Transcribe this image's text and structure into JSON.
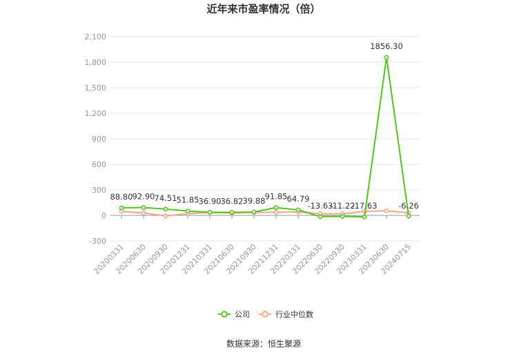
{
  "chart_data": {
    "type": "line",
    "title": "近年来市盈率情况（倍）",
    "categories": [
      "20200331",
      "20200630",
      "20200930",
      "20201231",
      "20210331",
      "20210630",
      "20210930",
      "20211231",
      "20220331",
      "20220630",
      "20220930",
      "20230331",
      "20230630",
      "20240715"
    ],
    "yticks": [
      "2,100",
      "1,800",
      "1,500",
      "1,200",
      "900",
      "600",
      "300",
      "0",
      "-300"
    ],
    "ylim": [
      -300,
      2100
    ],
    "grid": true,
    "legend_position": "bottom",
    "series": [
      {
        "name": "公司",
        "color": "#52c41a",
        "values": [
          88.8,
          92.9,
          74.51,
          51.85,
          36.9,
          36.82,
          39.88,
          91.85,
          64.79,
          -13.63,
          -11.22,
          -17.63,
          1856.3,
          -6.26
        ],
        "labels": [
          "88.80",
          "92.90",
          "74.51",
          "51.85",
          "36.90",
          "36.82",
          "39.88",
          "91.85",
          "64.79",
          "-13.63",
          "-11.22",
          "-17.63",
          "1856.30",
          "-6.26"
        ]
      },
      {
        "name": "行业中位数",
        "color": "#f4a582",
        "values": [
          48,
          28,
          -5,
          20,
          35,
          28,
          35,
          38,
          42,
          20,
          18,
          48,
          55,
          30
        ]
      }
    ]
  },
  "source": "数据来源：恒生聚源"
}
